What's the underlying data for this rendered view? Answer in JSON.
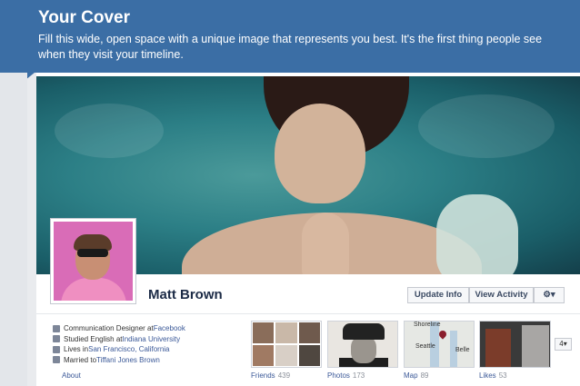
{
  "banner": {
    "title": "Your Cover",
    "description": "Fill this wide, open space with a unique image that represents you best. It's the first thing people see when they visit your timeline.",
    "color": "#3b6ea5"
  },
  "profile": {
    "name": "Matt Brown"
  },
  "actions": {
    "update_info": "Update Info",
    "view_activity": "View Activity",
    "gear": "⚙▾"
  },
  "info": [
    {
      "prefix": "Communication Designer at ",
      "link": "Facebook",
      "icon": "work-icon"
    },
    {
      "prefix": "Studied English at ",
      "link": "Indiana University",
      "icon": "education-icon"
    },
    {
      "prefix": "Lives in ",
      "link": "San Francisco, California",
      "icon": "home-icon"
    },
    {
      "prefix": "Married to ",
      "link": "Tiffani Jones Brown",
      "icon": "relationship-icon"
    }
  ],
  "about_label": "About",
  "sections": [
    {
      "label": "Friends",
      "count": "439"
    },
    {
      "label": "Photos",
      "count": "173"
    },
    {
      "label": "Map",
      "count": "89"
    },
    {
      "label": "Likes",
      "count": "53"
    }
  ],
  "map_labels": {
    "city1": "Seattle",
    "city2": "Belle",
    "top": "Shoreline"
  },
  "more_button": "4▾"
}
